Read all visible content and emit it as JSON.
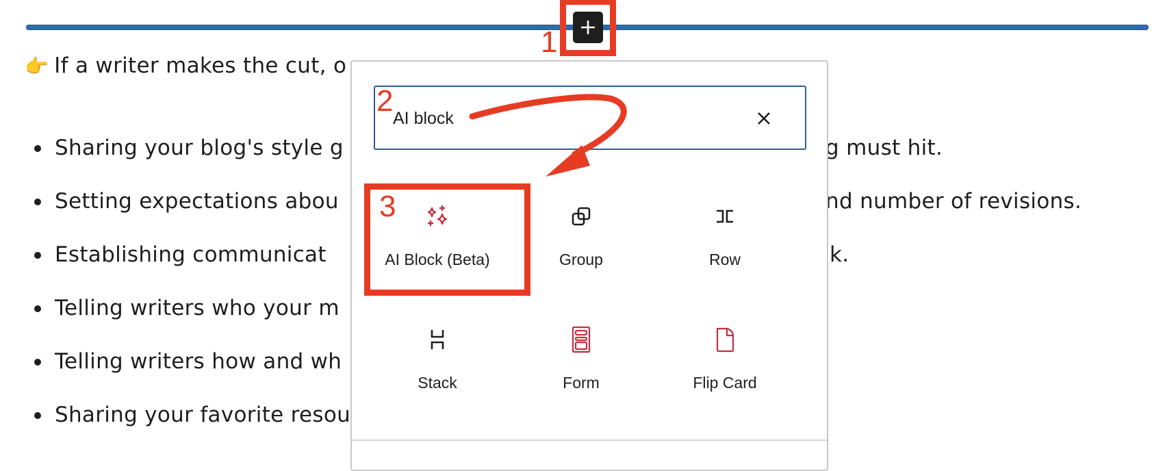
{
  "document": {
    "lead_emoji": "👉",
    "lead_text": "If a writer makes the cut, o",
    "bullets_left": [
      "Sharing your blog's style g",
      "Setting expectations abou",
      "Establishing communicat",
      "Telling writers who your m",
      "Telling writers how and wh",
      "Sharing your favorite resou"
    ],
    "bullets_right": [
      "g must hit.",
      "nd number of revisions.",
      "k.",
      "",
      "",
      ""
    ]
  },
  "inserter": {
    "button_icon": "plus-icon",
    "search": {
      "value": "AI block",
      "placeholder": "Search",
      "clear_icon": "close-icon"
    },
    "blocks": [
      {
        "label": "AI Block (Beta)",
        "icon": "sparkles-icon"
      },
      {
        "label": "Group",
        "icon": "group-icon"
      },
      {
        "label": "Row",
        "icon": "row-icon"
      },
      {
        "label": "Stack",
        "icon": "stack-icon"
      },
      {
        "label": "Form",
        "icon": "form-icon"
      },
      {
        "label": "Flip Card",
        "icon": "flip-card-icon"
      }
    ]
  },
  "annotations": {
    "step1": "1",
    "step2": "2",
    "step3": "3",
    "color": "#e63c23"
  },
  "colors": {
    "rule": "#2f6aae",
    "search_border": "#2f5a94",
    "block_accent": "#c5303f"
  }
}
